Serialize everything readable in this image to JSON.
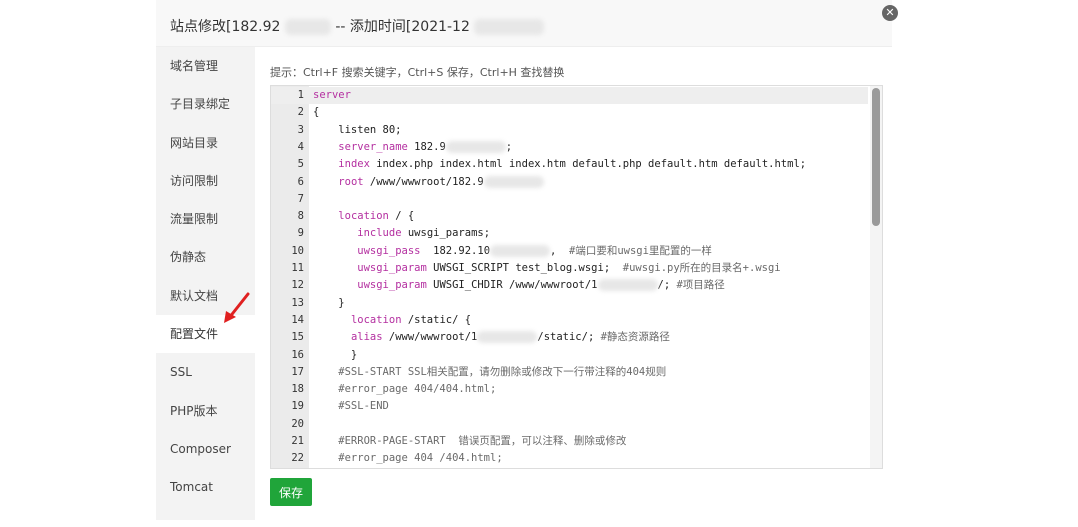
{
  "dialog": {
    "title_a": "站点修改[182.92",
    "title_b": "-- 添加时间[2021-12"
  },
  "sidebar": {
    "items": [
      {
        "label": "域名管理"
      },
      {
        "label": "子目录绑定"
      },
      {
        "label": "网站目录"
      },
      {
        "label": "访问限制"
      },
      {
        "label": "流量限制"
      },
      {
        "label": "伪静态"
      },
      {
        "label": "默认文档"
      },
      {
        "label": "配置文件"
      },
      {
        "label": "SSL"
      },
      {
        "label": "PHP版本"
      },
      {
        "label": "Composer"
      },
      {
        "label": "Tomcat"
      }
    ],
    "active": "配置文件"
  },
  "main": {
    "hint": "提示：Ctrl+F 搜索关键字，Ctrl+S 保存，Ctrl+H 查找替换",
    "save_label": "保存"
  },
  "editor": {
    "lines": [
      {
        "n": "1",
        "parts": [
          [
            "kw",
            "server"
          ]
        ]
      },
      {
        "n": "2",
        "parts": [
          [
            "",
            "{"
          ]
        ]
      },
      {
        "n": "3",
        "parts": [
          [
            "",
            "    listen 80;"
          ]
        ]
      },
      {
        "n": "4",
        "parts": [
          [
            "",
            "    "
          ],
          [
            "kw",
            "server_name"
          ],
          [
            "",
            " 182.9"
          ],
          [
            "blur",
            ""
          ],
          [
            "",
            ";"
          ]
        ]
      },
      {
        "n": "5",
        "parts": [
          [
            "",
            "    "
          ],
          [
            "kw",
            "index"
          ],
          [
            "",
            " index.php index.html index.htm default.php default.htm default.html;"
          ]
        ]
      },
      {
        "n": "6",
        "parts": [
          [
            "",
            "    "
          ],
          [
            "kw",
            "root"
          ],
          [
            "",
            " /www/wwwroot/182.9"
          ],
          [
            "blur",
            ""
          ]
        ]
      },
      {
        "n": "7",
        "parts": [
          [
            "",
            ""
          ]
        ]
      },
      {
        "n": "8",
        "parts": [
          [
            "",
            "    "
          ],
          [
            "kw",
            "location"
          ],
          [
            "",
            " / {"
          ]
        ]
      },
      {
        "n": "9",
        "parts": [
          [
            "",
            "       "
          ],
          [
            "kw",
            "include"
          ],
          [
            "",
            " uwsgi_params;"
          ]
        ]
      },
      {
        "n": "10",
        "parts": [
          [
            "",
            "       "
          ],
          [
            "kw",
            "uwsgi_pass"
          ],
          [
            "",
            "  182.92.10"
          ],
          [
            "blur",
            ""
          ],
          [
            "",
            ",  "
          ],
          [
            "cm",
            "#端口要和uwsgi里配置的一样"
          ]
        ]
      },
      {
        "n": "11",
        "parts": [
          [
            "",
            "       "
          ],
          [
            "kw",
            "uwsgi_param"
          ],
          [
            "",
            " UWSGI_SCRIPT test_blog.wsgi;  "
          ],
          [
            "cm",
            "#uwsgi.py所在的目录名+.wsgi"
          ]
        ]
      },
      {
        "n": "12",
        "parts": [
          [
            "",
            "       "
          ],
          [
            "kw",
            "uwsgi_param"
          ],
          [
            "",
            " UWSGI_CHDIR /www/wwwroot/1"
          ],
          [
            "blur",
            ""
          ],
          [
            "",
            "/; "
          ],
          [
            "cm",
            "#项目路径"
          ]
        ]
      },
      {
        "n": "13",
        "parts": [
          [
            "",
            "    }"
          ]
        ]
      },
      {
        "n": "14",
        "parts": [
          [
            "",
            "      "
          ],
          [
            "kw",
            "location"
          ],
          [
            "",
            " /static/ {"
          ]
        ]
      },
      {
        "n": "15",
        "parts": [
          [
            "",
            "      "
          ],
          [
            "kw",
            "alias"
          ],
          [
            "",
            " /www/wwwroot/1"
          ],
          [
            "blur",
            ""
          ],
          [
            "",
            "/static/; "
          ],
          [
            "cm",
            "#静态资源路径"
          ]
        ]
      },
      {
        "n": "16",
        "parts": [
          [
            "",
            "      }"
          ]
        ]
      },
      {
        "n": "17",
        "parts": [
          [
            "cm",
            "    #SSL-START SSL相关配置，请勿删除或修改下一行带注释的404规则"
          ]
        ]
      },
      {
        "n": "18",
        "parts": [
          [
            "cm",
            "    #error_page 404/404.html;"
          ]
        ]
      },
      {
        "n": "19",
        "parts": [
          [
            "cm",
            "    #SSL-END"
          ]
        ]
      },
      {
        "n": "20",
        "parts": [
          [
            "",
            ""
          ]
        ]
      },
      {
        "n": "21",
        "parts": [
          [
            "cm",
            "    #ERROR-PAGE-START  错误页配置，可以注释、删除或修改"
          ]
        ]
      },
      {
        "n": "22",
        "parts": [
          [
            "cm",
            "    #error_page 404 /404.html;"
          ]
        ]
      }
    ]
  },
  "colors": {
    "accent_green": "#20a53a",
    "keyword": "#b42fa0",
    "arrow": "#e02020"
  },
  "icons": {
    "close": "close-icon",
    "pointer": "red-arrow-icon"
  }
}
